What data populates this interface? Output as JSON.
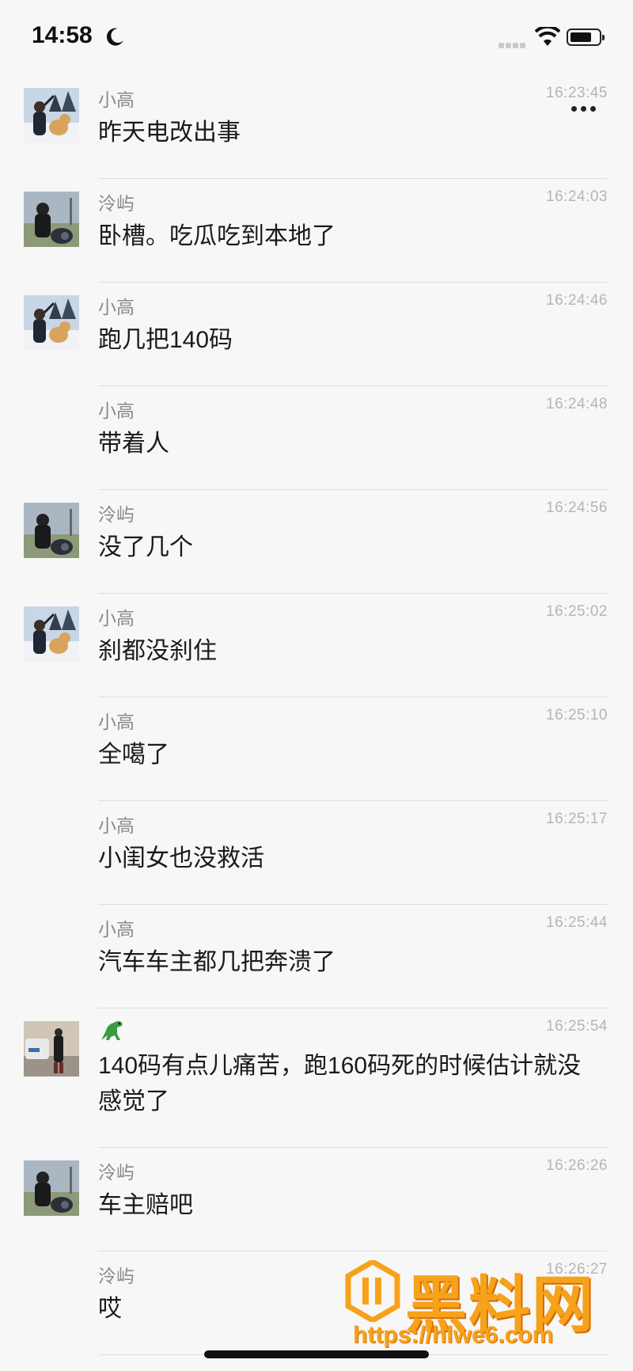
{
  "status": {
    "time": "14:58"
  },
  "messages": [
    {
      "sender": "小高",
      "time": "16:23:45",
      "text": "昨天电改出事",
      "avatar": "dog-avatar"
    },
    {
      "sender": "泠屿",
      "time": "16:24:03",
      "text": "卧槽。吃瓜吃到本地了",
      "avatar": "moto-avatar"
    },
    {
      "sender": "小高",
      "time": "16:24:46",
      "text": "跑几把140码",
      "avatar": "dog-avatar"
    },
    {
      "sender": "小高",
      "time": "16:24:48",
      "text": "带着人",
      "avatar": ""
    },
    {
      "sender": "泠屿",
      "time": "16:24:56",
      "text": "没了几个",
      "avatar": "moto-avatar"
    },
    {
      "sender": "小高",
      "time": "16:25:02",
      "text": "刹都没刹住",
      "avatar": "dog-avatar"
    },
    {
      "sender": "小高",
      "time": "16:25:10",
      "text": "全噶了",
      "avatar": ""
    },
    {
      "sender": "小高",
      "time": "16:25:17",
      "text": "小闺女也没救活",
      "avatar": ""
    },
    {
      "sender": "小高",
      "time": "16:25:44",
      "text": "汽车车主都几把奔溃了",
      "avatar": ""
    },
    {
      "sender": "🦖",
      "time": "16:25:54",
      "text": "140码有点儿痛苦，跑160码死的时候估计就没感觉了",
      "avatar": "car-avatar"
    },
    {
      "sender": "泠屿",
      "time": "16:26:26",
      "text": "车主赔吧",
      "avatar": "moto-avatar"
    },
    {
      "sender": "泠屿",
      "time": "16:26:27",
      "text": "哎",
      "avatar": ""
    }
  ],
  "watermark": {
    "title": "黑料网",
    "url": "https://hlwe6.com"
  }
}
